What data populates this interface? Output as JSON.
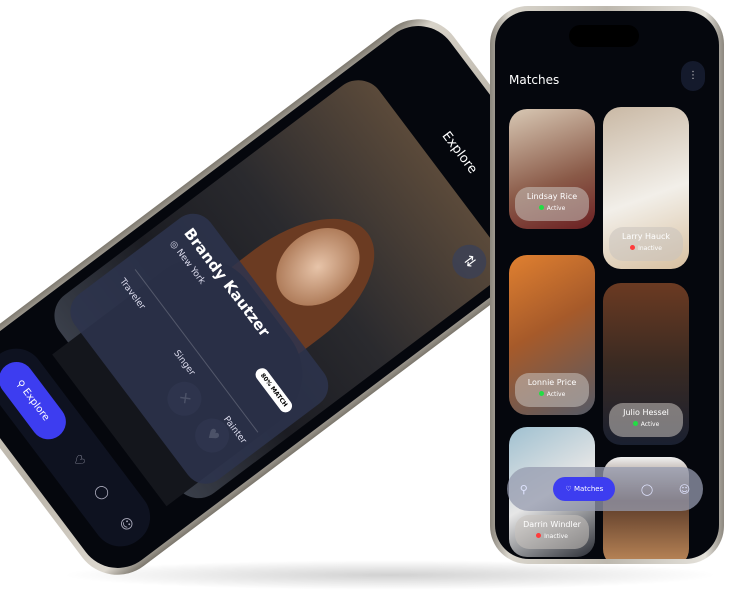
{
  "explore": {
    "title": "Explore",
    "profile": {
      "name": "Brandy Kautzer",
      "location": "New York",
      "tags": [
        "Traveler",
        "Singer",
        "Painter"
      ],
      "match": "80% MATCH"
    },
    "nav": {
      "active": "Explore",
      "icons": [
        "search-icon",
        "matches-icon",
        "chat-icon",
        "profile-icon"
      ]
    }
  },
  "matches": {
    "title": "Matches",
    "cards": [
      {
        "name": "Lindsay Rice",
        "status": "Active"
      },
      {
        "name": "Larry Hauck",
        "status": "Inactive"
      },
      {
        "name": "Lonnie Price",
        "status": "Active"
      },
      {
        "name": "Julio Hessel",
        "status": "Active"
      },
      {
        "name": "Darrin Windler",
        "status": "Inactive"
      }
    ],
    "nav": {
      "active": "Matches"
    }
  },
  "colors": {
    "accent": "#3d3df0",
    "active": "#22dd44",
    "inactive": "#ff3b3b"
  }
}
